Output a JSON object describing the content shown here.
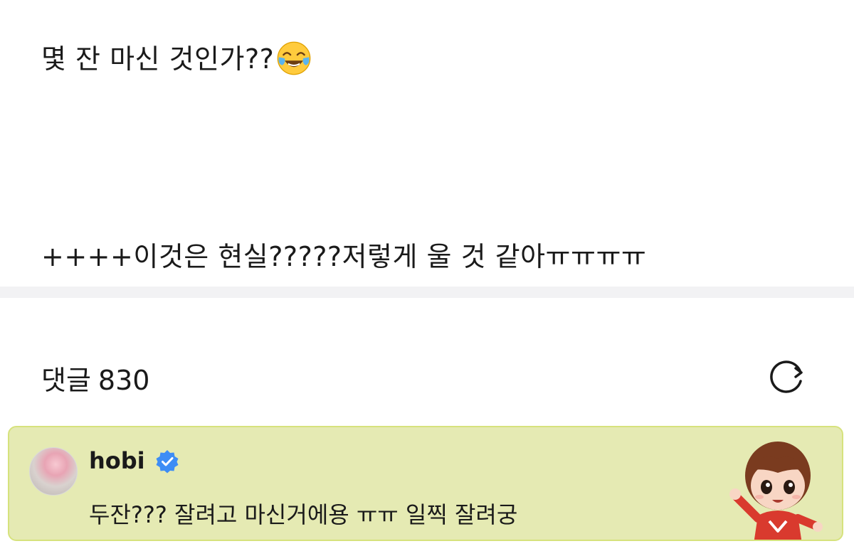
{
  "post": {
    "line1_text": "몇 잔 마신 것인가??",
    "line1_emoji": "face-with-tears-of-joy-icon",
    "line2_text": "++++이것은 현실?????저렇게 울 것 같아ㅠㅠㅠㅠ"
  },
  "comments": {
    "label": "댓글",
    "count": "830",
    "refresh_icon": "refresh-icon"
  },
  "comment": {
    "author": "hobi",
    "verified_icon": "verified-badge-icon",
    "text": "두잔??? 잘려고 마신거에용 ㅠㅠ 일찍 잘려궁",
    "highlight_bg": "#e5eab3",
    "highlight_border": "#d6e27d",
    "sticker_icon": "character-sticker-icon"
  }
}
